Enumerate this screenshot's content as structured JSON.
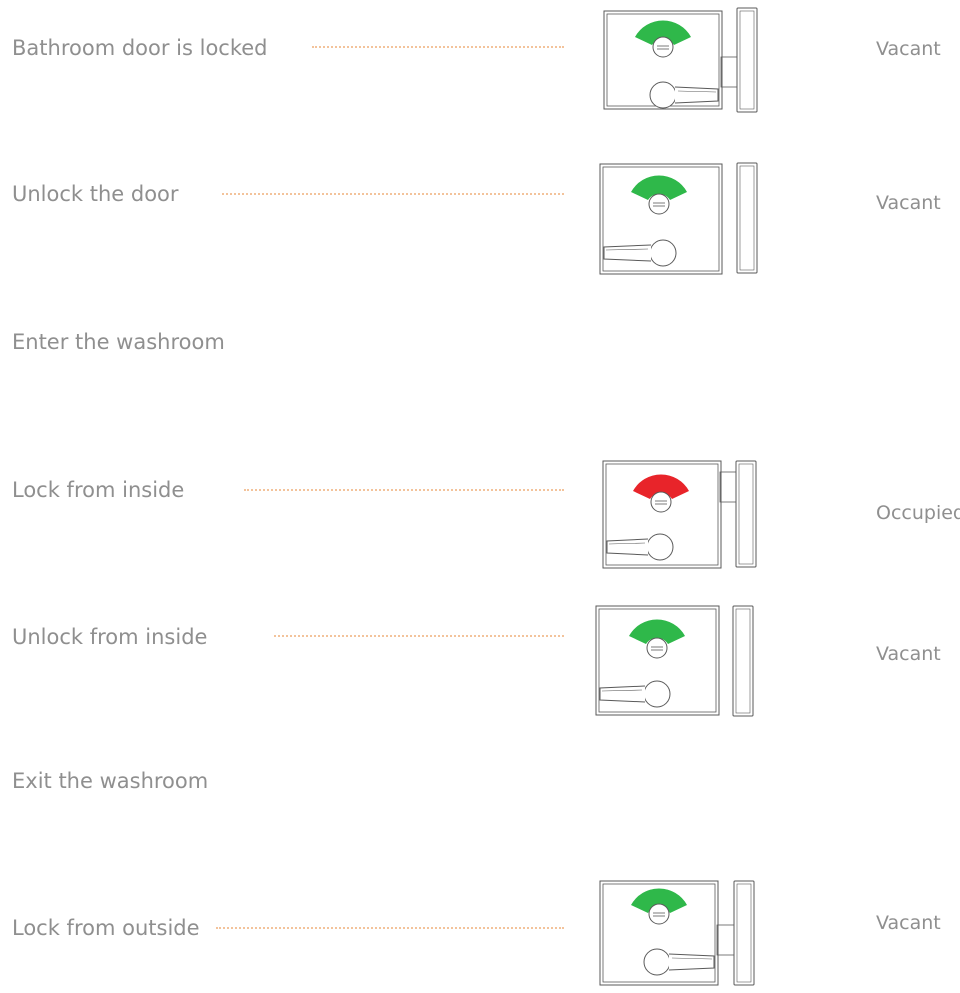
{
  "steps": [
    {
      "label": "Bathroom door is locked",
      "state": "Vacant",
      "indicator": "green",
      "handle": "right",
      "bolt": "extended"
    },
    {
      "label": "Unlock the door",
      "state": "Vacant",
      "indicator": "green",
      "handle": "left",
      "bolt": "retracted"
    },
    {
      "label": "Enter the washroom"
    },
    {
      "label": "Lock from inside",
      "state": "Occupied",
      "indicator": "red",
      "handle": "left",
      "bolt": "extended"
    },
    {
      "label": "Unlock from inside",
      "state": "Vacant",
      "indicator": "green",
      "handle": "left",
      "bolt": "retracted"
    },
    {
      "label": "Exit the washroom"
    },
    {
      "label": "Lock from outside",
      "state": "Vacant",
      "indicator": "green",
      "handle": "right",
      "bolt": "extended"
    }
  ],
  "colors": {
    "label_text": "#8f8f8f",
    "leader_line": "#f3c39b",
    "vacant_green": "#2fb84a",
    "occupied_red": "#e8242a",
    "outline": "#5a5a5a"
  }
}
